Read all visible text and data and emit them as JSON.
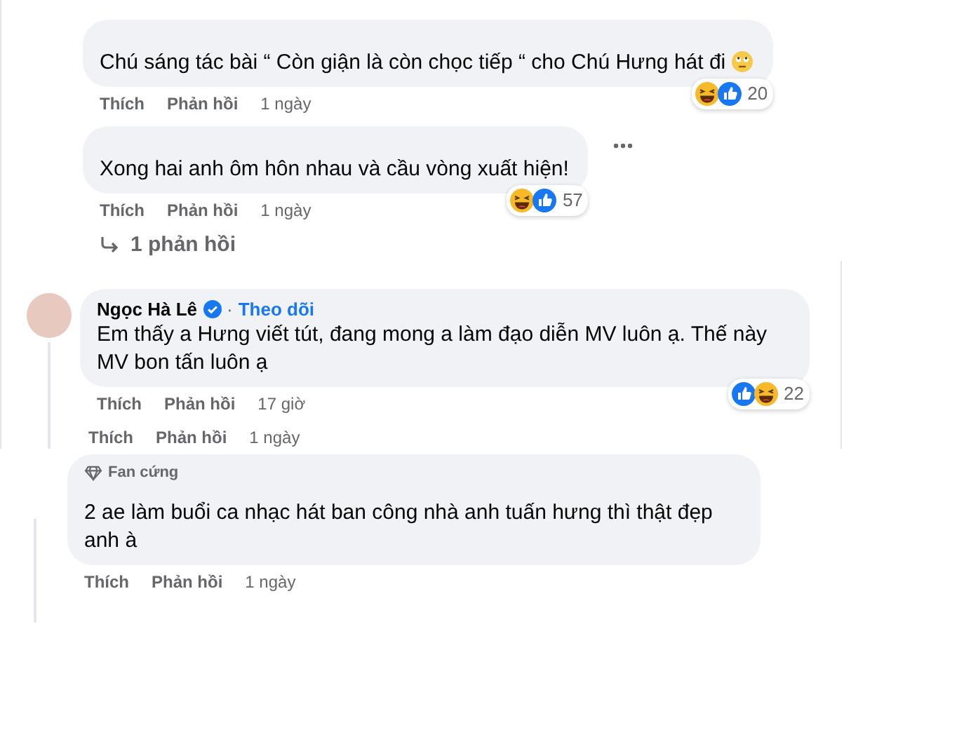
{
  "segments": [
    {
      "comments": [
        {
          "text": "Chú sáng tác bài “ Còn giận là còn chọc tiếp “ cho Chú Hưng hát đi",
          "emoji_at_end": true,
          "reactions": [
            {
              "kind": "haha"
            },
            {
              "kind": "like"
            }
          ],
          "reaction_count": "20",
          "actions": [
            "Thích",
            "Phản hồi"
          ],
          "time": "1 ngày"
        },
        {
          "text": "Xong hai anh ôm hôn nhau và cầu vòng xuất hiện!",
          "more_button": true,
          "reactions": [
            {
              "kind": "haha"
            },
            {
              "kind": "like"
            }
          ],
          "reaction_count": "57",
          "actions": [
            "Thích",
            "Phản hồi"
          ],
          "time": "1 ngày"
        }
      ],
      "replies_link": "1 phản hồi"
    },
    {
      "comments": [
        {
          "avatar": true,
          "author": "Ngọc Hà Lê",
          "verified": true,
          "separator": "·",
          "follow": "Theo dõi",
          "text": "Em thấy a Hưng viết tút, đang mong a làm đạo diễn MV luôn ạ. Thế này MV bon tấn luôn ạ",
          "reactions": [
            {
              "kind": "like"
            },
            {
              "kind": "haha"
            }
          ],
          "reaction_count": "22",
          "actions": [
            "Thích",
            "Phản hồi"
          ],
          "time": "17 giờ"
        }
      ],
      "trailing_actions": {
        "actions": [
          "Thích",
          "Phản hồi"
        ],
        "time": "1 ngày"
      }
    },
    {
      "comments": [
        {
          "badge": "Fan cứng",
          "text": "2 ae làm buổi ca nhạc hát ban công nhà anh tuấn hưng thì thật đẹp anh à",
          "actions": [
            "Thích",
            "Phản hồi"
          ],
          "time": "1 ngày"
        }
      ]
    }
  ]
}
